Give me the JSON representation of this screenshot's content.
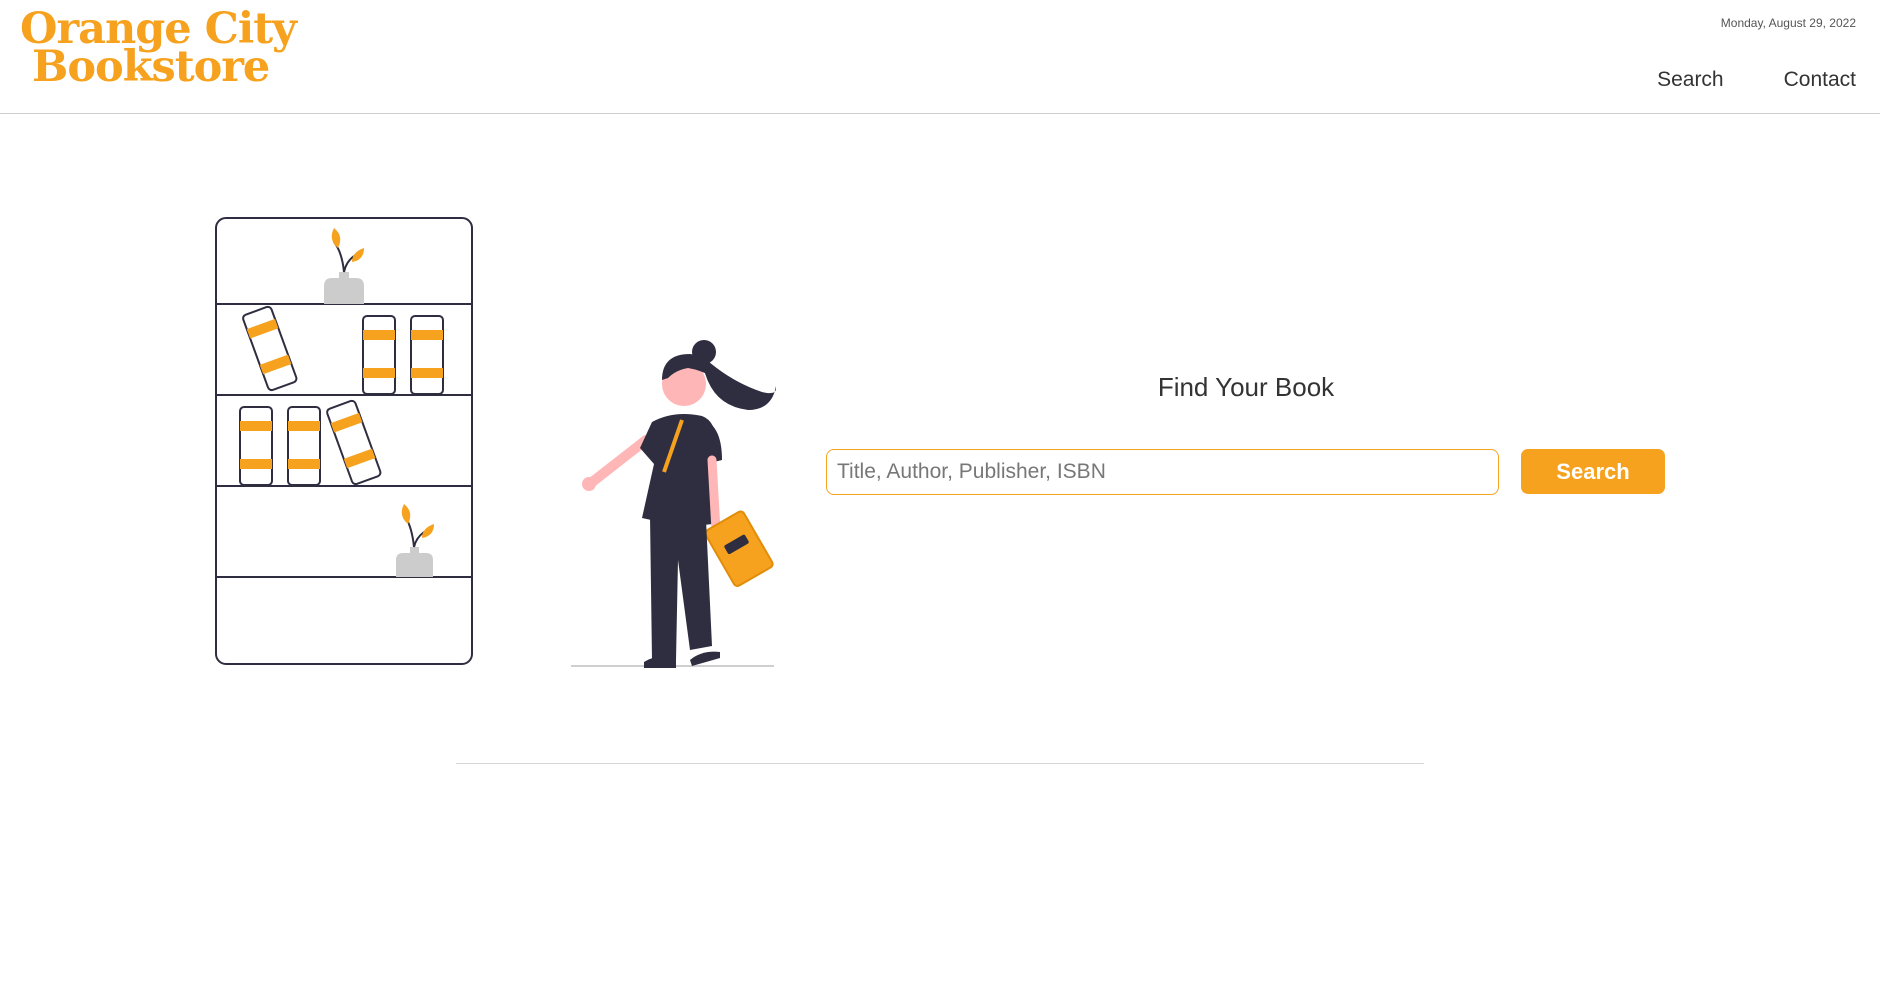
{
  "header": {
    "logo_line1": "Orange City",
    "logo_line2": "Bookstore",
    "date": "Monday, August 29, 2022",
    "nav": [
      {
        "label": "Search"
      },
      {
        "label": "Contact"
      }
    ]
  },
  "main": {
    "title": "Find Your Book",
    "search": {
      "placeholder": "Title, Author, Publisher, ISBN",
      "value": "",
      "button_label": "Search"
    }
  },
  "colors": {
    "accent": "#f6a21e",
    "ink": "#2f2e41",
    "skin": "#ffb6b6",
    "pot": "#cccccc"
  }
}
